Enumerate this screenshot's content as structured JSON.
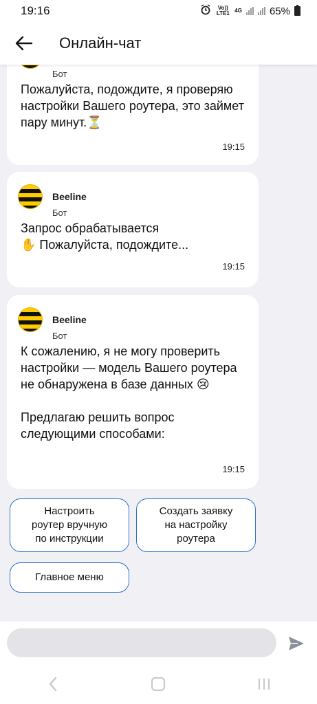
{
  "status": {
    "time": "19:16",
    "volte": "Vo)) LTE1",
    "net": "4G",
    "battery": "65%"
  },
  "header": {
    "title": "Онлайн-чат"
  },
  "messages": [
    {
      "role": "Бот",
      "text": "Пожалуйста, подождите, я проверяю настройки Вашего роутера, это займет пару минут.⏳",
      "time": "19:15"
    },
    {
      "sender": "Beeline",
      "role": "Бот",
      "text": "Запрос обрабатывается\n✋ Пожалуйста, подождите...",
      "time": "19:15"
    },
    {
      "sender": "Beeline",
      "role": "Бот",
      "text": "К сожалению, я не могу проверить настройки — модель Вашего роутера не обнаружена в базе данных 😢\n\nПредлагаю решить вопрос следующими способами:",
      "time": "19:15"
    }
  ],
  "quick_replies": [
    "Настроить\nроутер вручную\nпо инструкции",
    "Создать заявку\nна настройку\nроутера",
    "Главное меню"
  ],
  "input": {
    "placeholder": ""
  },
  "colors": {
    "accent": "#2d72c4",
    "brand_yellow": "#ffcc00",
    "background": "#f1f1f5"
  }
}
